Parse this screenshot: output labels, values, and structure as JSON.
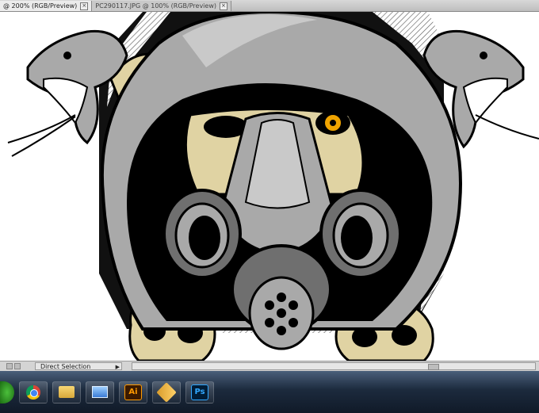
{
  "document_tabs": [
    {
      "label": "@ 200% (RGB/Preview)",
      "active": true
    },
    {
      "label": "PC290117.JPG @ 100% (RGB/Preview)",
      "active": false
    }
  ],
  "status_bar": {
    "tool_label": "Direct Selection"
  },
  "taskbar": {
    "apps": [
      {
        "name": "start-orb",
        "icon": "windows-orb-icon"
      },
      {
        "name": "chrome",
        "icon": "chrome-icon"
      },
      {
        "name": "file-explorer",
        "icon": "folder-icon"
      },
      {
        "name": "window",
        "icon": "window-icon"
      },
      {
        "name": "illustrator",
        "icon": "illustrator-icon",
        "label": "Ai"
      },
      {
        "name": "tool",
        "icon": "tool-icon"
      },
      {
        "name": "photoshop",
        "icon": "photoshop-icon",
        "label": "Ps"
      }
    ]
  },
  "colors": {
    "hood_gray": "#a9a9a9",
    "skin_tan": "#e0d3a3",
    "eye_orange": "#f0a400",
    "outline": "#000000"
  }
}
